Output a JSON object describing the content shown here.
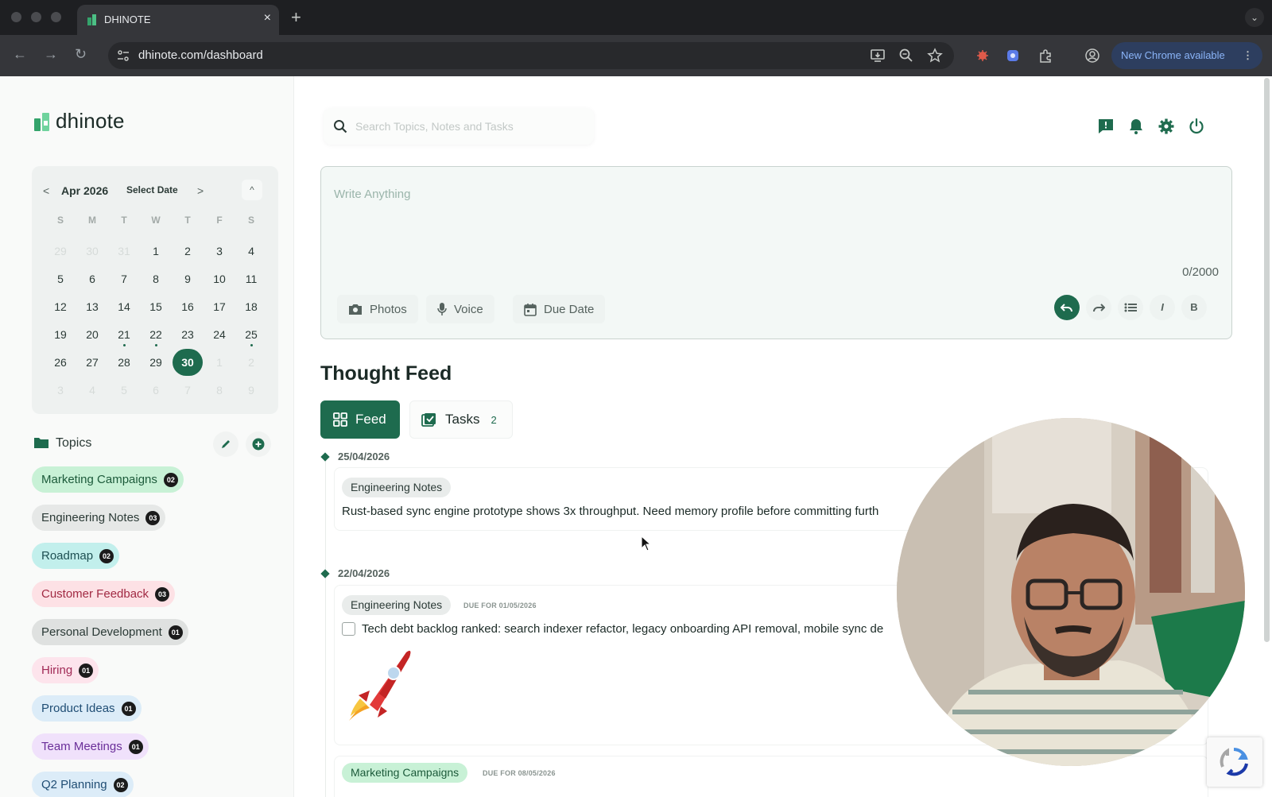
{
  "browser": {
    "tab_title": "DHINOTE",
    "tab_close": "×",
    "new_tab": "+",
    "tab_menu": "⌄",
    "url": "dhinote.com/dashboard",
    "update_label": "New Chrome available",
    "update_menu": "⋮",
    "back": "←",
    "forward": "→",
    "reload": "↻"
  },
  "app": {
    "brand": "dhinote",
    "accent": "#1e6b4e",
    "search_placeholder": "Search Topics, Notes and Tasks"
  },
  "calendar": {
    "prev": "<",
    "month": "Apr 2026",
    "select_date": "Select Date",
    "next": ">",
    "collapse": "^",
    "weekdays": [
      "S",
      "M",
      "T",
      "W",
      "T",
      "F",
      "S"
    ],
    "days": [
      [
        "29",
        "30",
        "31",
        "1",
        "2",
        "3",
        "4"
      ],
      [
        "5",
        "6",
        "7",
        "8",
        "9",
        "10",
        "11"
      ],
      [
        "12",
        "13",
        "14",
        "15",
        "16",
        "17",
        "18"
      ],
      [
        "19",
        "20",
        "21",
        "22",
        "23",
        "24",
        "25"
      ],
      [
        "26",
        "27",
        "28",
        "29",
        "30",
        "1",
        "2"
      ],
      [
        "3",
        "4",
        "5",
        "6",
        "7",
        "8",
        "9"
      ]
    ],
    "selected_day": "30"
  },
  "topics": {
    "label": "Topics",
    "items": [
      {
        "name": "Marketing Campaigns",
        "count": "02",
        "bg": "#c8f1d6",
        "fg": "#1c5a3a"
      },
      {
        "name": "Engineering Notes",
        "count": "03",
        "bg": "#e6e8e7",
        "fg": "#2b3a36"
      },
      {
        "name": "Roadmap",
        "count": "02",
        "bg": "#c2efec",
        "fg": "#1d4f52"
      },
      {
        "name": "Customer Feedback",
        "count": "03",
        "bg": "#fde1e5",
        "fg": "#a12a43"
      },
      {
        "name": "Personal Development",
        "count": "01",
        "bg": "#dfe1e0",
        "fg": "#2b3a36"
      },
      {
        "name": "Hiring",
        "count": "01",
        "bg": "#fde4ec",
        "fg": "#a12a56"
      },
      {
        "name": "Product Ideas",
        "count": "01",
        "bg": "#dcecf8",
        "fg": "#1f4d74"
      },
      {
        "name": "Team Meetings",
        "count": "01",
        "bg": "#f0e1fb",
        "fg": "#6a2e99"
      },
      {
        "name": "Q2 Planning",
        "count": "02",
        "bg": "#dcecf8",
        "fg": "#1f4d74"
      }
    ]
  },
  "composer": {
    "placeholder": "Write Anything",
    "char_count": "0/2000",
    "photos": "Photos",
    "voice": "Voice",
    "due_date": "Due Date",
    "italic": "I",
    "bold": "B"
  },
  "feed": {
    "title": "Thought Feed",
    "tab_feed": "Feed",
    "tab_tasks": "Tasks",
    "tasks_count": "2",
    "entries": [
      {
        "date": "25/04/2026",
        "tag": "Engineering Notes",
        "text": "Rust-based sync engine prototype shows 3x throughput. Need memory profile before committing furth"
      },
      {
        "date": "22/04/2026",
        "tag": "Engineering Notes",
        "due": "DUE FOR 01/05/2026",
        "text": "Tech debt backlog ranked: search indexer refactor, legacy onboarding API removal, mobile sync de"
      },
      {
        "tag": "Marketing Campaigns",
        "due": "DUE FOR 08/05/2026"
      }
    ]
  }
}
